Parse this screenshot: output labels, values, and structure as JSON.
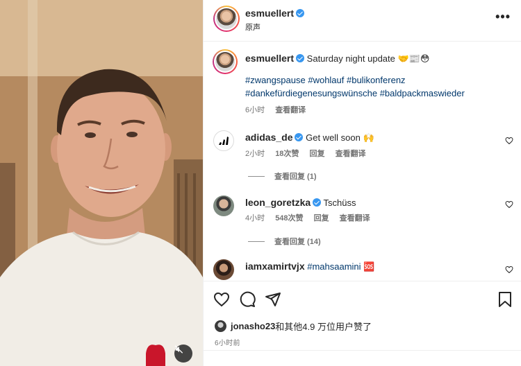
{
  "post": {
    "author": "esmuellert",
    "audio_label": "原声",
    "more_icon": "more-horizontal-icon"
  },
  "caption": {
    "author": "esmuellert",
    "text": "Saturday night update 🤝📰😳",
    "hashtags_line1": "#zwangspause #wohlauf #bulikonferenz",
    "hashtags_line2": "#dankefürdiegenesungswünsche #baldpackmaswieder",
    "time": "6小时",
    "translate": "查看翻译"
  },
  "comments": [
    {
      "author": "adidas_de",
      "text": "Get well soon 🙌",
      "time": "2小时",
      "likes": "18次赞",
      "reply": "回复",
      "translate": "查看翻译",
      "view_replies": "查看回复 (1)"
    },
    {
      "author": "leon_goretzka",
      "text": "Tschüss",
      "time": "4小时",
      "likes": "548次赞",
      "reply": "回复",
      "translate": "查看翻译",
      "view_replies": "查看回复 (14)"
    },
    {
      "author": "iamxamirtvjx",
      "text": "#mahsaamini 🆘"
    }
  ],
  "actions": {
    "liked_by_user": "jonasho23",
    "liked_by_rest": "和其他4.9 万位用户赞了",
    "time_ago": "6小时前"
  },
  "colors": {
    "hashtag": "#00376b",
    "verified": "#3897f0",
    "muted_text": "#737373"
  }
}
